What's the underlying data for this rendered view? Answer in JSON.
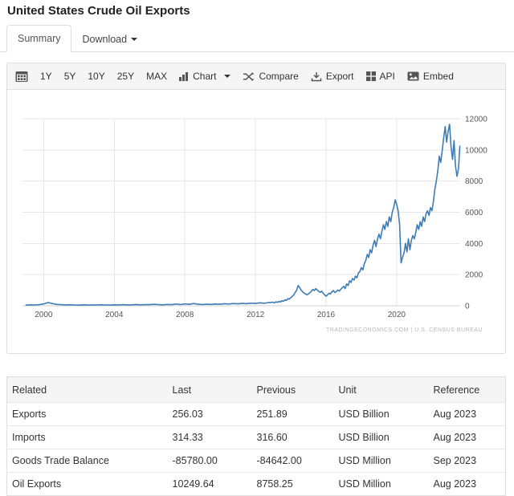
{
  "header": {
    "title": "United States Crude Oil Exports"
  },
  "tabs": {
    "summary": "Summary",
    "download": "Download"
  },
  "toolbar": {
    "ranges": [
      "1Y",
      "5Y",
      "10Y",
      "25Y",
      "MAX"
    ],
    "chart": "Chart",
    "compare": "Compare",
    "export": "Export",
    "api": "API",
    "embed": "Embed"
  },
  "chart_data": {
    "type": "line",
    "line_color": "#3e7cb5",
    "grid_color": "#e6e6e6",
    "axis_line_color": "#d0d0d0",
    "x_ticks": [
      2000,
      2004,
      2008,
      2012,
      2016,
      2020
    ],
    "y_ticks": [
      0,
      2000,
      4000,
      6000,
      8000,
      10000,
      12000
    ],
    "xlim": [
      1998.8,
      2023.6
    ],
    "ylim": [
      0,
      12000
    ],
    "legend": "off",
    "grid": "on",
    "attribution": "TRADINGECONOMICS.COM  |  U.S. CENSUS BUREAU",
    "series": [
      {
        "points": [
          [
            1999.0,
            45
          ],
          [
            1999.25,
            60
          ],
          [
            1999.5,
            50
          ],
          [
            1999.75,
            70
          ],
          [
            2000.0,
            120
          ],
          [
            2000.25,
            210
          ],
          [
            2000.5,
            140
          ],
          [
            2000.75,
            90
          ],
          [
            2001.0,
            70
          ],
          [
            2001.25,
            55
          ],
          [
            2001.5,
            65
          ],
          [
            2001.75,
            50
          ],
          [
            2002.0,
            40
          ],
          [
            2002.25,
            60
          ],
          [
            2002.5,
            45
          ],
          [
            2002.75,
            58
          ],
          [
            2003.0,
            50
          ],
          [
            2003.25,
            66
          ],
          [
            2003.5,
            54
          ],
          [
            2003.75,
            46
          ],
          [
            2004.0,
            60
          ],
          [
            2004.25,
            50
          ],
          [
            2004.5,
            72
          ],
          [
            2004.75,
            56
          ],
          [
            2005.0,
            64
          ],
          [
            2005.25,
            82
          ],
          [
            2005.5,
            60
          ],
          [
            2005.75,
            76
          ],
          [
            2006.0,
            70
          ],
          [
            2006.25,
            92
          ],
          [
            2006.5,
            78
          ],
          [
            2006.75,
            64
          ],
          [
            2007.0,
            86
          ],
          [
            2007.25,
            70
          ],
          [
            2007.5,
            112
          ],
          [
            2007.75,
            76
          ],
          [
            2008.0,
            120
          ],
          [
            2008.25,
            92
          ],
          [
            2008.5,
            142
          ],
          [
            2008.75,
            100
          ],
          [
            2009.0,
            82
          ],
          [
            2009.25,
            96
          ],
          [
            2009.5,
            86
          ],
          [
            2009.75,
            112
          ],
          [
            2010.0,
            100
          ],
          [
            2010.25,
            132
          ],
          [
            2010.5,
            112
          ],
          [
            2010.75,
            142
          ],
          [
            2011.0,
            122
          ],
          [
            2011.25,
            162
          ],
          [
            2011.5,
            132
          ],
          [
            2011.75,
            172
          ],
          [
            2012.0,
            150
          ],
          [
            2012.25,
            192
          ],
          [
            2012.5,
            162
          ],
          [
            2012.75,
            212
          ],
          [
            2013.0,
            225
          ],
          [
            2013.083,
            185
          ],
          [
            2013.167,
            255
          ],
          [
            2013.25,
            215
          ],
          [
            2013.333,
            285
          ],
          [
            2013.417,
            245
          ],
          [
            2013.5,
            325
          ],
          [
            2013.583,
            295
          ],
          [
            2013.667,
            385
          ],
          [
            2013.75,
            345
          ],
          [
            2013.833,
            455
          ],
          [
            2013.917,
            425
          ],
          [
            2014.0,
            520
          ],
          [
            2014.083,
            600
          ],
          [
            2014.167,
            700
          ],
          [
            2014.25,
            850
          ],
          [
            2014.333,
            1000
          ],
          [
            2014.417,
            1300
          ],
          [
            2014.5,
            1180
          ],
          [
            2014.583,
            1020
          ],
          [
            2014.667,
            900
          ],
          [
            2014.75,
            820
          ],
          [
            2014.833,
            760
          ],
          [
            2014.917,
            700
          ],
          [
            2015.0,
            760
          ],
          [
            2015.083,
            840
          ],
          [
            2015.167,
            930
          ],
          [
            2015.25,
            1050
          ],
          [
            2015.333,
            980
          ],
          [
            2015.417,
            1100
          ],
          [
            2015.5,
            1010
          ],
          [
            2015.583,
            930
          ],
          [
            2015.667,
            860
          ],
          [
            2015.75,
            940
          ],
          [
            2015.833,
            820
          ],
          [
            2015.917,
            700
          ],
          [
            2016.0,
            620
          ],
          [
            2016.083,
            700
          ],
          [
            2016.167,
            810
          ],
          [
            2016.25,
            760
          ],
          [
            2016.333,
            900
          ],
          [
            2016.417,
            980
          ],
          [
            2016.5,
            850
          ],
          [
            2016.583,
            920
          ],
          [
            2016.667,
            1010
          ],
          [
            2016.75,
            940
          ],
          [
            2016.833,
            1060
          ],
          [
            2016.917,
            1150
          ],
          [
            2017.0,
            1250
          ],
          [
            2017.083,
            1100
          ],
          [
            2017.167,
            1400
          ],
          [
            2017.25,
            1300
          ],
          [
            2017.333,
            1600
          ],
          [
            2017.417,
            1500
          ],
          [
            2017.5,
            1750
          ],
          [
            2017.583,
            1650
          ],
          [
            2017.667,
            1900
          ],
          [
            2017.75,
            1800
          ],
          [
            2017.833,
            2100
          ],
          [
            2017.917,
            2200
          ],
          [
            2018.0,
            2450
          ],
          [
            2018.083,
            2300
          ],
          [
            2018.167,
            2700
          ],
          [
            2018.25,
            2900
          ],
          [
            2018.333,
            3300
          ],
          [
            2018.417,
            3100
          ],
          [
            2018.5,
            3600
          ],
          [
            2018.583,
            3400
          ],
          [
            2018.667,
            3900
          ],
          [
            2018.75,
            4200
          ],
          [
            2018.833,
            3800
          ],
          [
            2018.917,
            4300
          ],
          [
            2019.0,
            4600
          ],
          [
            2019.083,
            4300
          ],
          [
            2019.167,
            4800
          ],
          [
            2019.25,
            5200
          ],
          [
            2019.333,
            4900
          ],
          [
            2019.417,
            5400
          ],
          [
            2019.5,
            5100
          ],
          [
            2019.583,
            5700
          ],
          [
            2019.667,
            5400
          ],
          [
            2019.75,
            6000
          ],
          [
            2019.833,
            6300
          ],
          [
            2019.917,
            6800
          ],
          [
            2020.0,
            6500
          ],
          [
            2020.083,
            6100
          ],
          [
            2020.167,
            5200
          ],
          [
            2020.25,
            2750
          ],
          [
            2020.333,
            3100
          ],
          [
            2020.417,
            3400
          ],
          [
            2020.5,
            4000
          ],
          [
            2020.583,
            3450
          ],
          [
            2020.667,
            4300
          ],
          [
            2020.75,
            3600
          ],
          [
            2020.833,
            4200
          ],
          [
            2020.917,
            4500
          ],
          [
            2021.0,
            4300
          ],
          [
            2021.083,
            4700
          ],
          [
            2021.167,
            5200
          ],
          [
            2021.25,
            4900
          ],
          [
            2021.333,
            5400
          ],
          [
            2021.417,
            5100
          ],
          [
            2021.5,
            5700
          ],
          [
            2021.583,
            5400
          ],
          [
            2021.667,
            5900
          ],
          [
            2021.75,
            6100
          ],
          [
            2021.833,
            5800
          ],
          [
            2021.917,
            6300
          ],
          [
            2022.0,
            6100
          ],
          [
            2022.083,
            6700
          ],
          [
            2022.167,
            7500
          ],
          [
            2022.25,
            8000
          ],
          [
            2022.333,
            8700
          ],
          [
            2022.417,
            9600
          ],
          [
            2022.5,
            9200
          ],
          [
            2022.583,
            10000
          ],
          [
            2022.667,
            10800
          ],
          [
            2022.75,
            11500
          ],
          [
            2022.833,
            10500
          ],
          [
            2022.917,
            11200
          ],
          [
            2023.0,
            11650
          ],
          [
            2023.083,
            10200
          ],
          [
            2023.167,
            9400
          ],
          [
            2023.25,
            10600
          ],
          [
            2023.333,
            9000
          ],
          [
            2023.417,
            8300
          ],
          [
            2023.5,
            8758
          ],
          [
            2023.583,
            10250
          ]
        ]
      }
    ]
  },
  "table": {
    "columns": [
      "Related",
      "Last",
      "Previous",
      "Unit",
      "Reference"
    ],
    "rows": [
      [
        "Exports",
        "256.03",
        "251.89",
        "USD Billion",
        "Aug 2023"
      ],
      [
        "Imports",
        "314.33",
        "316.60",
        "USD Billion",
        "Aug 2023"
      ],
      [
        "Goods Trade Balance",
        "-85780.00",
        "-84642.00",
        "USD Million",
        "Sep 2023"
      ],
      [
        "Oil Exports",
        "10249.64",
        "8758.25",
        "USD Million",
        "Aug 2023"
      ]
    ]
  }
}
